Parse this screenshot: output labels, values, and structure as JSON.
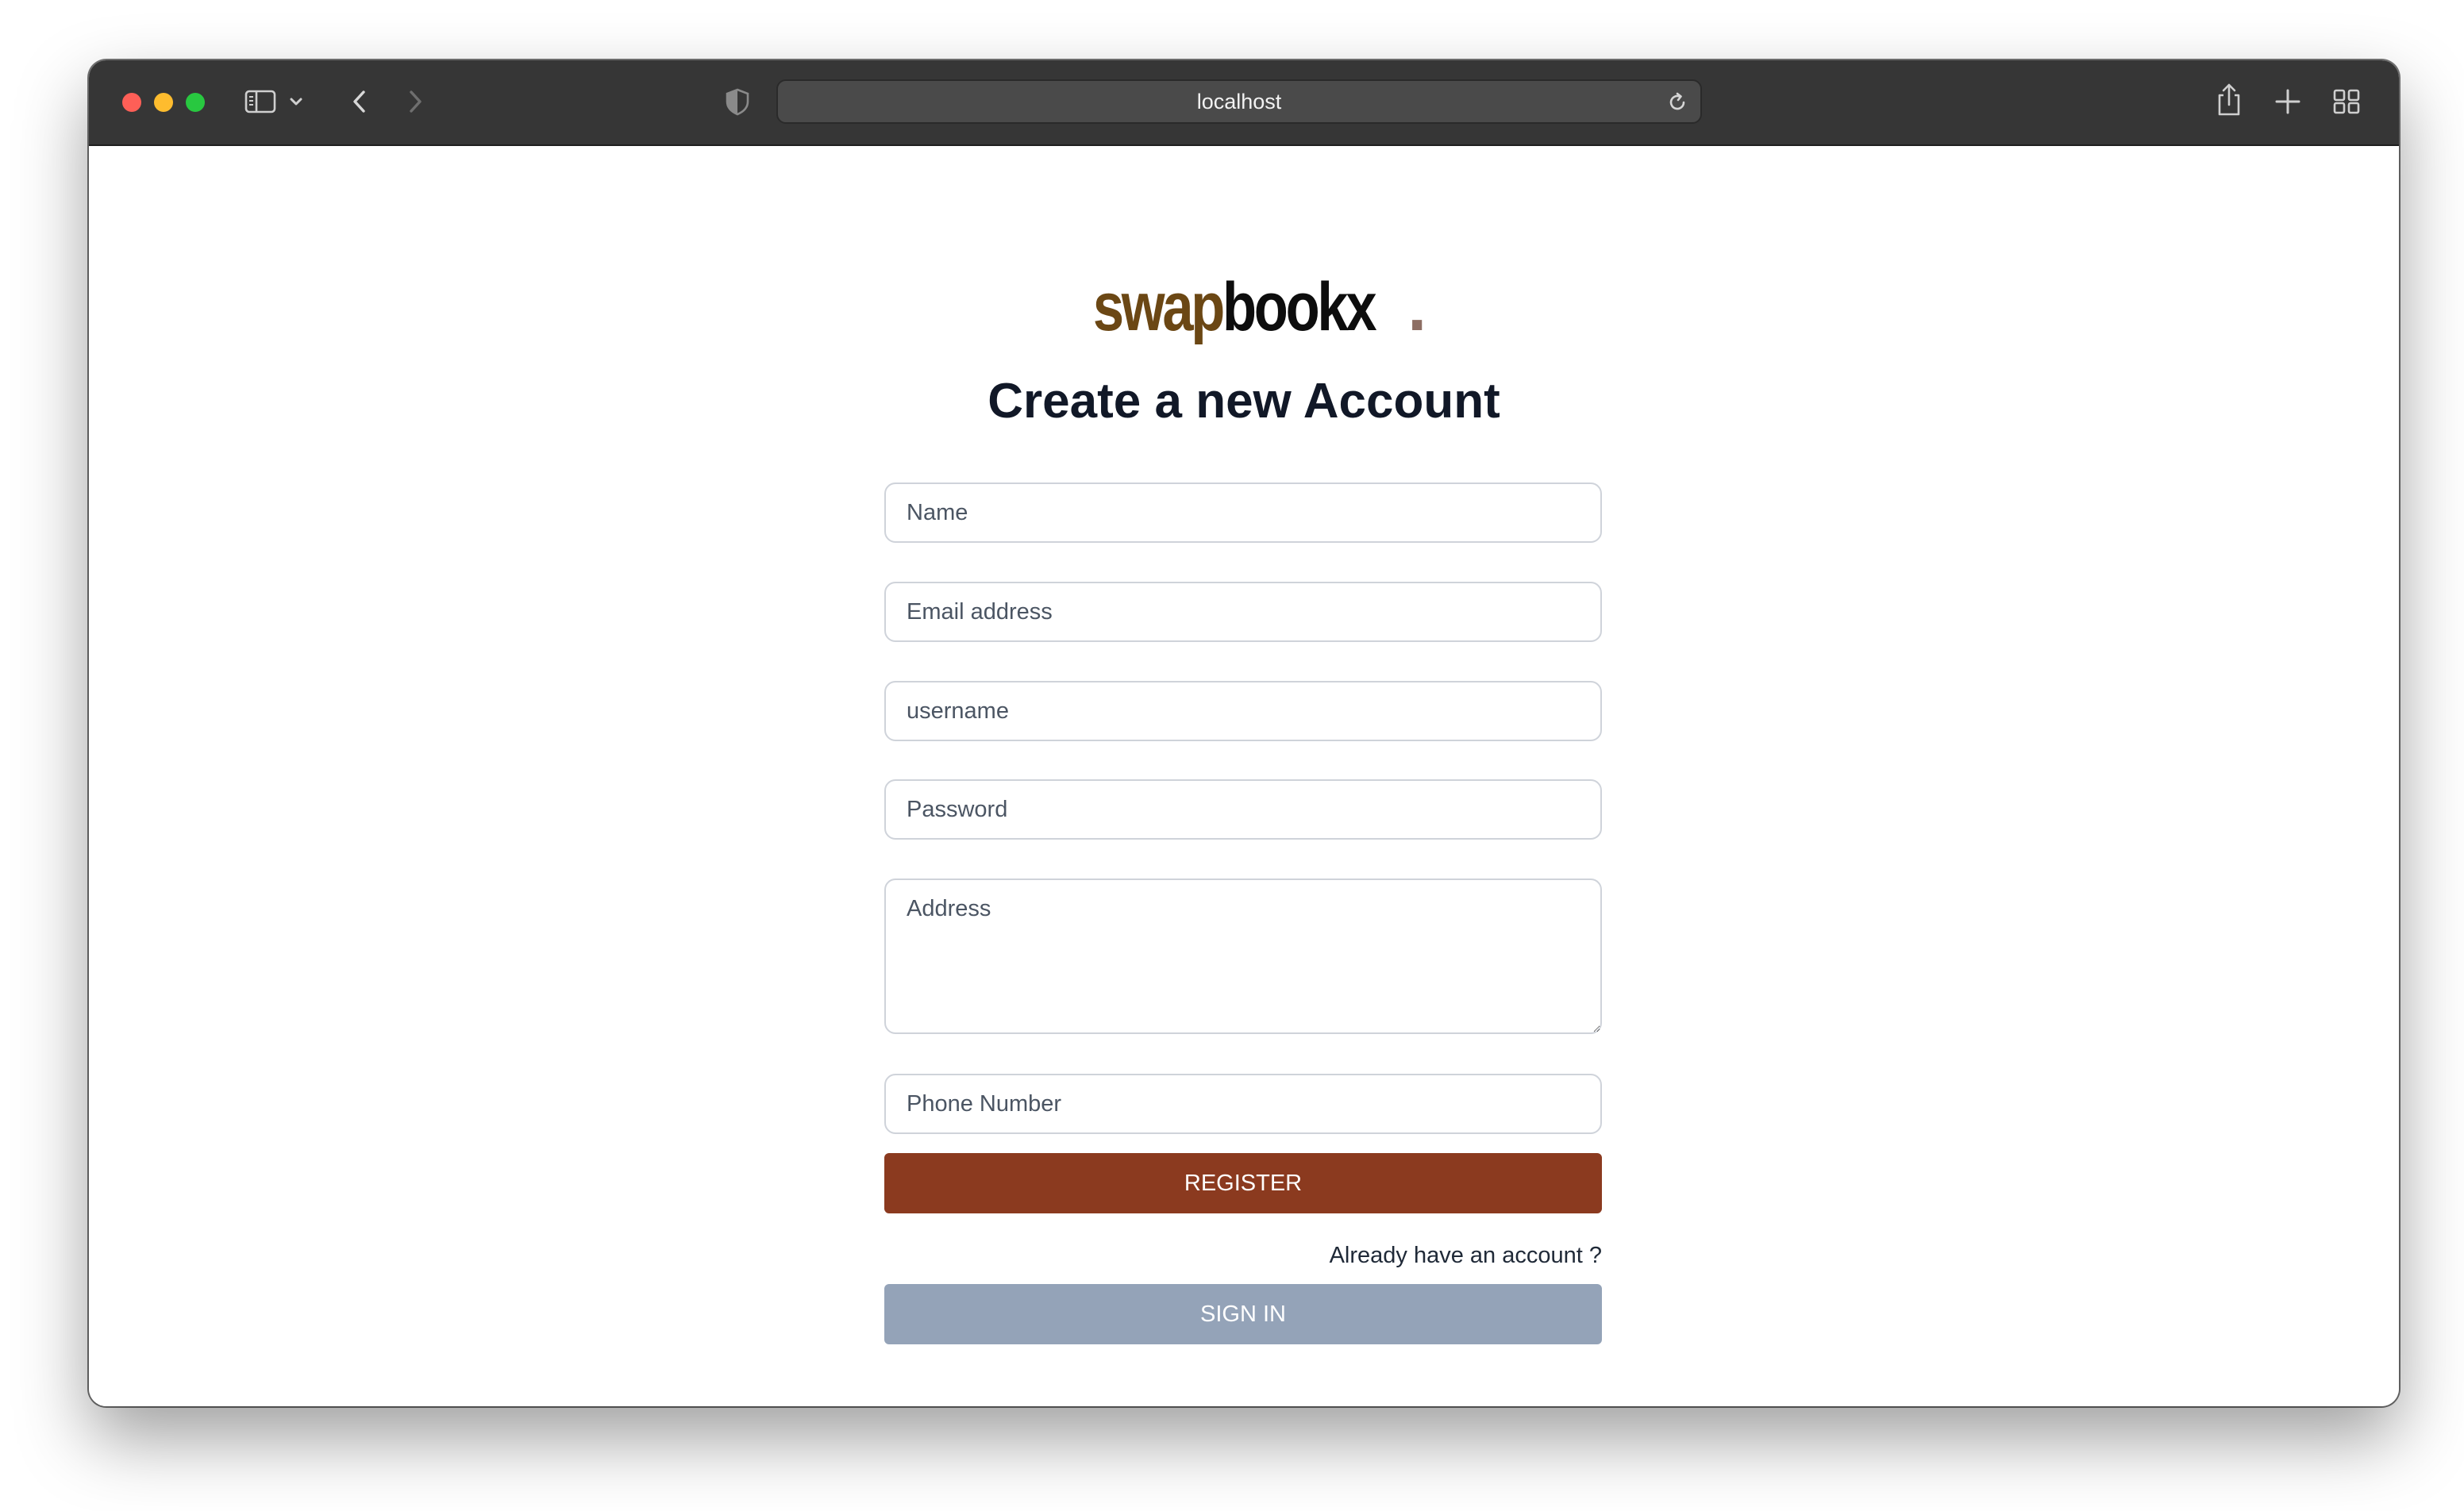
{
  "browser": {
    "url": "localhost"
  },
  "brand": {
    "logo_part1": "swap",
    "logo_part2": "bookx",
    "logo_dot": ".",
    "color_part1": "#6b4714",
    "color_part2": "#0d0d0d"
  },
  "page": {
    "title": "Create a new Account"
  },
  "form": {
    "name_placeholder": "Name",
    "email_placeholder": "Email address",
    "username_placeholder": "username",
    "password_placeholder": "Password",
    "address_placeholder": "Address",
    "phone_placeholder": "Phone Number",
    "register_label": "REGISTER",
    "already_text": "Already have an account ?",
    "signin_label": "SIGN IN"
  },
  "colors": {
    "register_button": "#8b3a1f",
    "signin_button": "#94a3b8",
    "toolbar": "#363636"
  }
}
